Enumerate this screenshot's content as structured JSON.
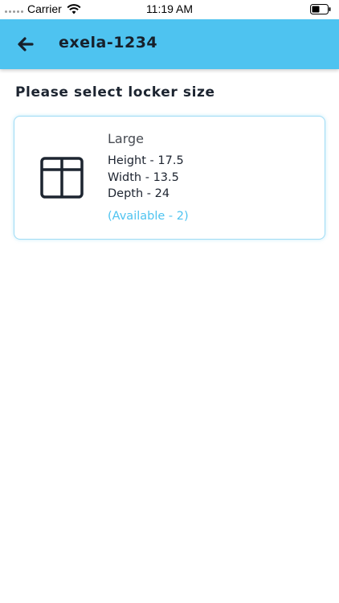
{
  "status_bar": {
    "carrier": "Carrier",
    "time": "11:19 AM"
  },
  "header": {
    "title": "exela-1234",
    "back_icon": "arrow-left-icon",
    "background_color": "#4ec3f0"
  },
  "main": {
    "section_title": "Please select locker size",
    "lockers": [
      {
        "size": "Large",
        "height": "Height - 17.5",
        "width": "Width - 13.5",
        "depth": "Depth - 24",
        "availability": "(Available - 2)",
        "icon": "locker-grid-icon"
      }
    ]
  }
}
